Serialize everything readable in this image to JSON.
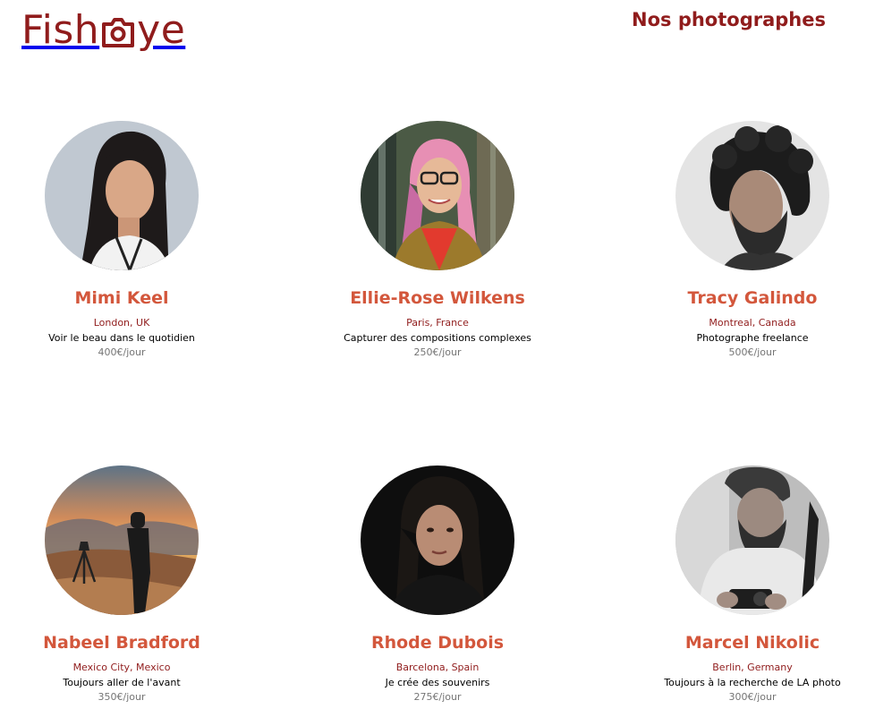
{
  "header": {
    "logo_left": "Fish",
    "logo_right": "ye",
    "nav_title": "Nos photographes"
  },
  "colors": {
    "brand": "#901C1C",
    "accent": "#D3573C",
    "price": "#757575"
  },
  "photographers": [
    {
      "name": "Mimi Keel",
      "location": "London, UK",
      "tagline": "Voir le beau dans le quotidien",
      "price": "400€/jour"
    },
    {
      "name": "Ellie-Rose Wilkens",
      "location": "Paris, France",
      "tagline": "Capturer des compositions complexes",
      "price": "250€/jour"
    },
    {
      "name": "Tracy Galindo",
      "location": "Montreal, Canada",
      "tagline": "Photographe freelance",
      "price": "500€/jour"
    },
    {
      "name": "Nabeel Bradford",
      "location": "Mexico City, Mexico",
      "tagline": "Toujours aller de l'avant",
      "price": "350€/jour"
    },
    {
      "name": "Rhode Dubois",
      "location": "Barcelona, Spain",
      "tagline": "Je crée des souvenirs",
      "price": "275€/jour"
    },
    {
      "name": "Marcel Nikolic",
      "location": "Berlin, Germany",
      "tagline": "Toujours à la recherche de LA photo",
      "price": "300€/jour"
    }
  ]
}
